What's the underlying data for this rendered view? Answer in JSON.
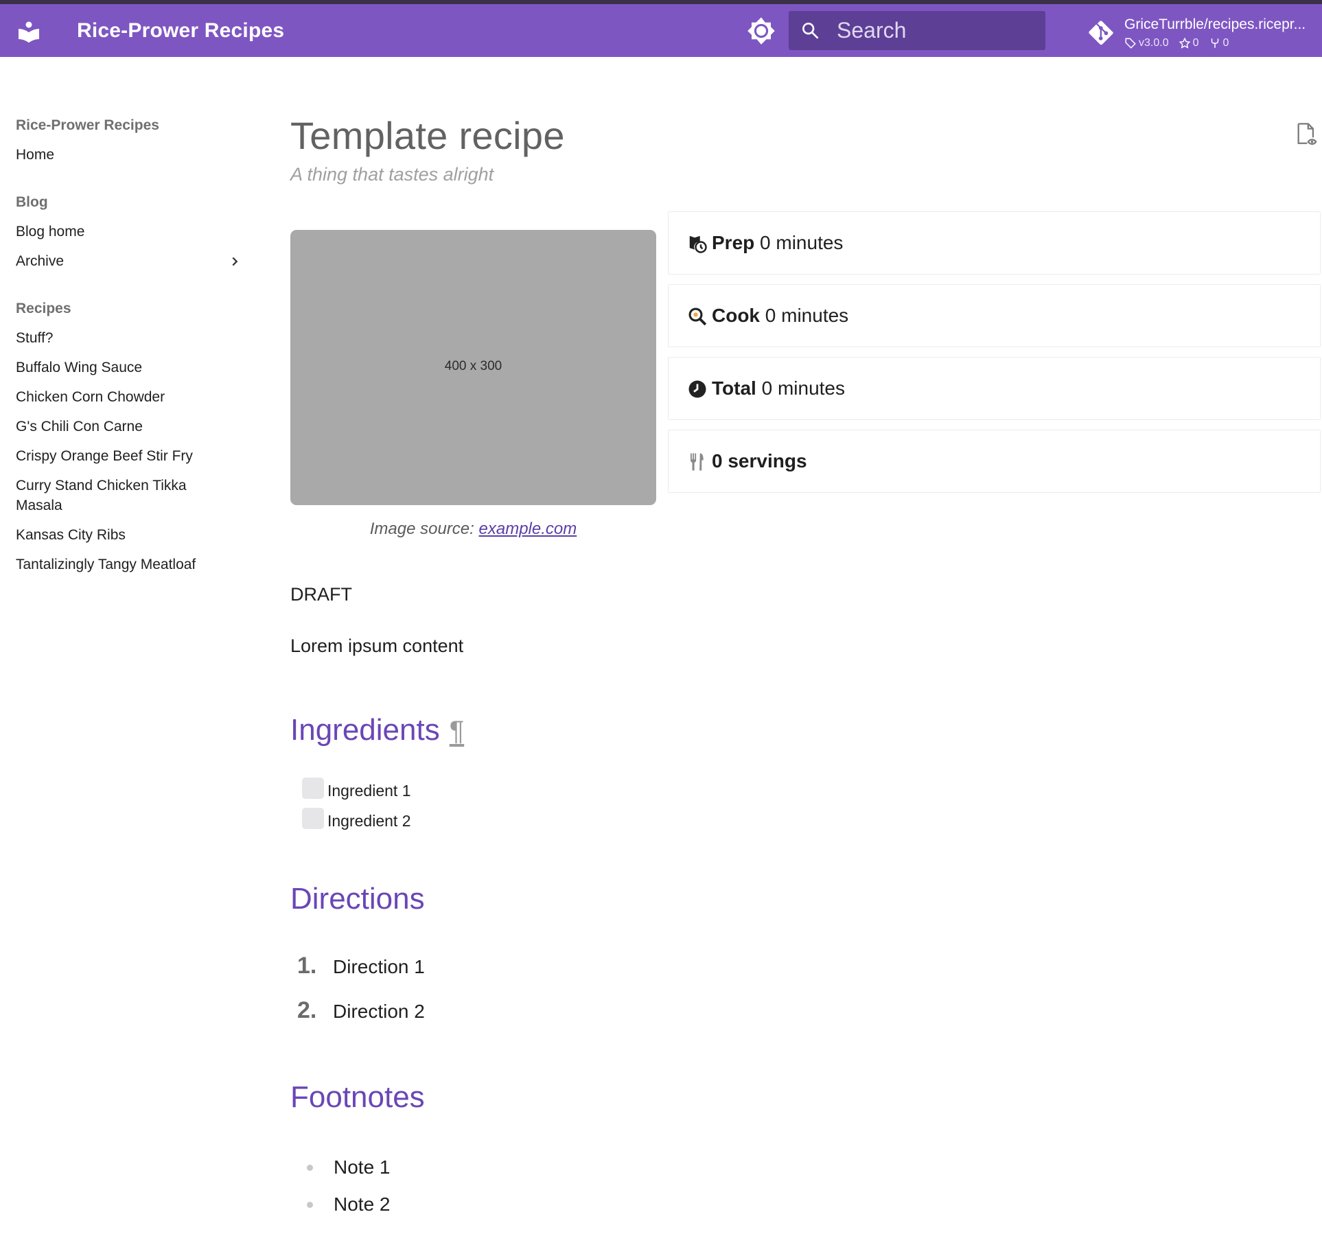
{
  "header": {
    "site_title": "Rice-Prower Recipes",
    "search_placeholder": "Search",
    "repo_name": "GriceTurrble/recipes.ricepr...",
    "repo_version": "v3.0.0",
    "repo_stars": "0",
    "repo_forks": "0",
    "bar_color": "#7e56c2"
  },
  "sidebar": {
    "title": "Rice-Prower Recipes",
    "home": "Home",
    "blog_title": "Blog",
    "blog_home": "Blog home",
    "archive": "Archive",
    "recipes_title": "Recipes",
    "recipes": [
      "Stuff?",
      "Buffalo Wing Sauce",
      "Chicken Corn Chowder",
      "G's Chili Con Carne",
      "Crispy Orange Beef Stir Fry",
      "Curry Stand Chicken Tikka Masala",
      "Kansas City Ribs",
      "Tantalizingly Tangy Meatloaf"
    ]
  },
  "page": {
    "title": "Template recipe",
    "subtitle": "A thing that tastes alright",
    "image_label": "400 x 300",
    "image_caption_prefix": "Image source: ",
    "image_caption_link": "example.com",
    "stats": {
      "prep_label": "Prep",
      "prep_value": "0 minutes",
      "cook_label": "Cook",
      "cook_value": "0 minutes",
      "total_label": "Total",
      "total_value": "0 minutes",
      "servings_label": "0 servings"
    },
    "draft": "DRAFT",
    "lorem": "Lorem ipsum content",
    "ingredients_heading": "Ingredients",
    "permalink_symbol": "¶",
    "ingredients": [
      "Ingredient 1",
      "Ingredient 2"
    ],
    "directions_heading": "Directions",
    "directions": [
      {
        "num": "1.",
        "text": "Direction 1"
      },
      {
        "num": "2.",
        "text": "Direction 2"
      }
    ],
    "footnotes_heading": "Footnotes",
    "footnotes": [
      "Note 1",
      "Note 2"
    ],
    "accent_color": "#6a46b6"
  }
}
